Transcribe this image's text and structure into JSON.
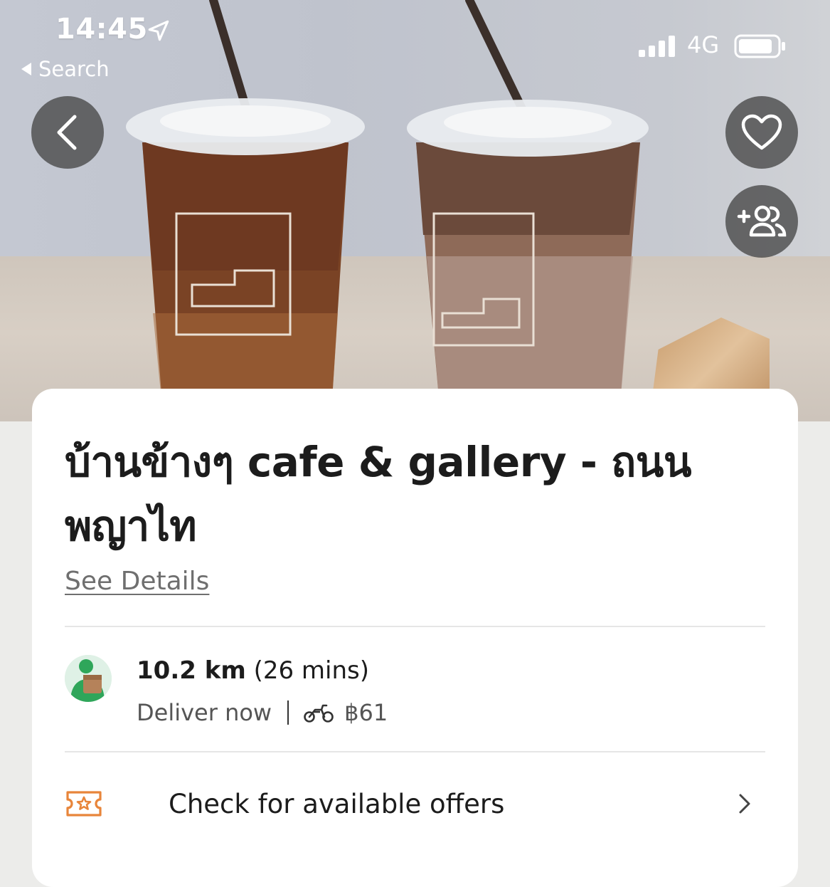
{
  "status_bar": {
    "time": "14:45",
    "back_app_label": "Search",
    "network": "4G"
  },
  "hero": {
    "alt_subject": "two iced coffee cups with straws"
  },
  "actions": {
    "back_icon": "chevron-left-icon",
    "favorite_icon": "heart-icon",
    "group_order_icon": "add-people-icon"
  },
  "store": {
    "title": "บ้านข้างๆ cafe & gallery - ถนนพญาไท",
    "see_details": "See Details"
  },
  "delivery": {
    "distance": "10.2 km",
    "duration": "(26 mins)",
    "mode": "Deliver now",
    "fee": "฿61"
  },
  "offers": {
    "label": "Check for available offers"
  },
  "colors": {
    "accent_orange": "#e8853a",
    "text_primary": "#1c1c1c",
    "text_secondary": "#6f6f6f",
    "divider": "#e6e6e6"
  }
}
